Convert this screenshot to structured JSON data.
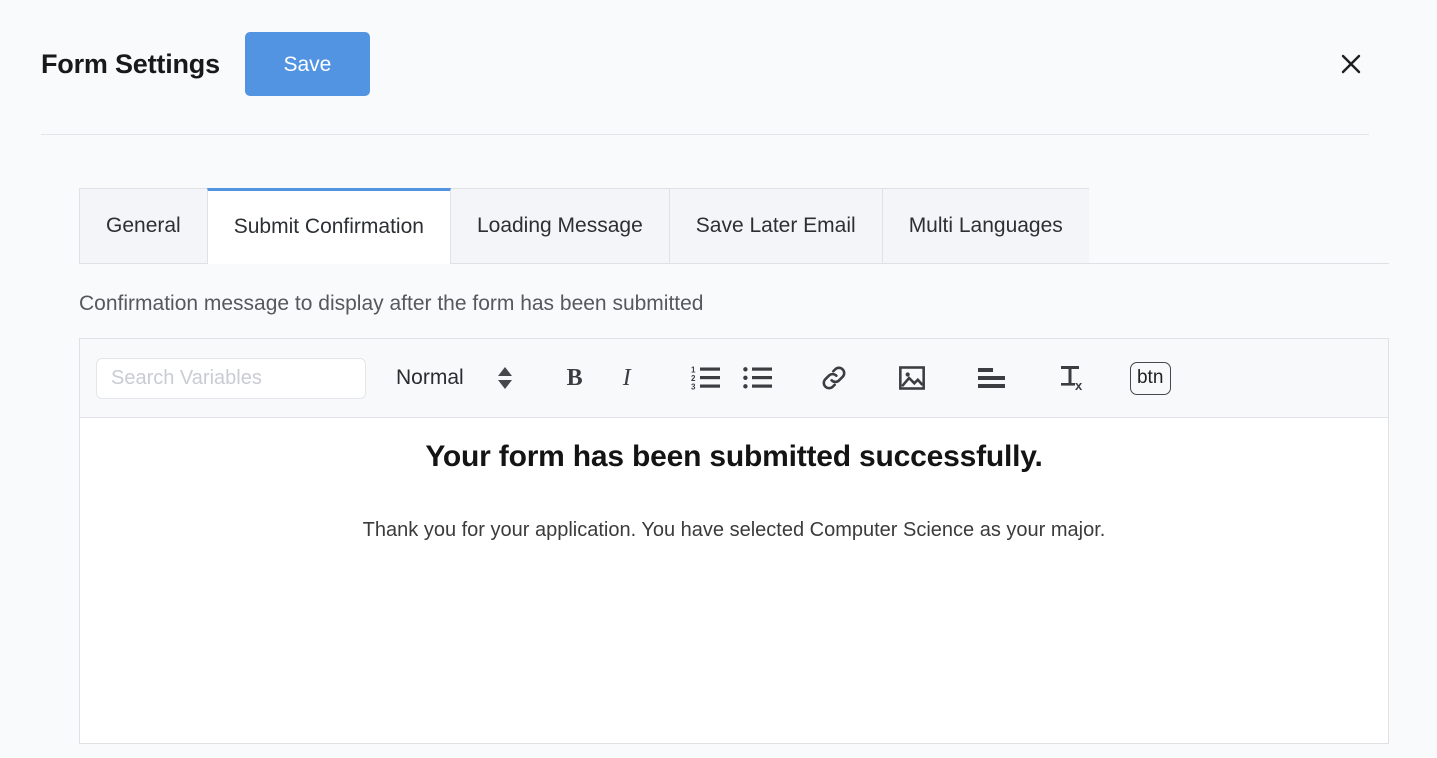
{
  "header": {
    "title": "Form Settings",
    "save_label": "Save",
    "close_icon": "close-icon"
  },
  "tabs": [
    {
      "label": "General",
      "active": false
    },
    {
      "label": "Submit Confirmation",
      "active": true
    },
    {
      "label": "Loading Message",
      "active": false
    },
    {
      "label": "Save Later Email",
      "active": false
    },
    {
      "label": "Multi Languages",
      "active": false
    }
  ],
  "editor": {
    "description": "Confirmation message to display after the form has been submitted",
    "toolbar": {
      "search_placeholder": "Search Variables",
      "search_value": "",
      "format_label": "Normal",
      "format_caret_icon": "chevron-updown-icon",
      "bold_label": "B",
      "italic_label": "I",
      "ordered_list_icon": "ordered-list-icon",
      "unordered_list_icon": "unordered-list-icon",
      "link_icon": "link-icon",
      "image_icon": "image-icon",
      "align_icon": "align-left-icon",
      "clear_format_icon": "clear-format-icon",
      "button_label": "btn"
    },
    "content": {
      "heading": "Your form has been submitted successfully.",
      "paragraph": "Thank you for your application. You have selected Computer Science as your major."
    }
  },
  "colors": {
    "accent": "#5294e2",
    "background": "#f9fafb",
    "border": "#dfe1e5",
    "tab_inactive": "#f4f5f8"
  }
}
